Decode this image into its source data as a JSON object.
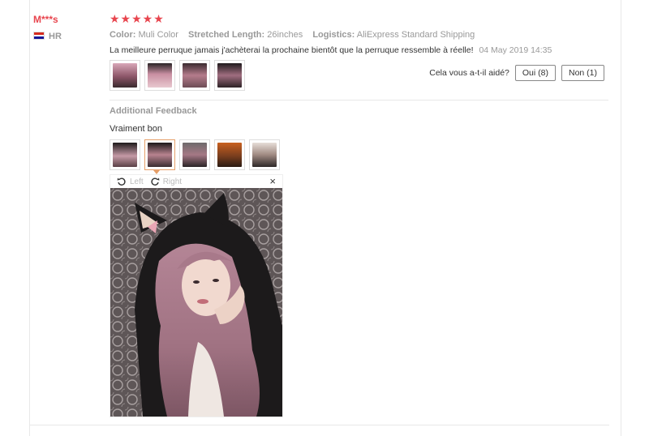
{
  "reviewer": {
    "name": "M***s",
    "country": "HR"
  },
  "rating": {
    "stars": "★★★★★"
  },
  "meta": {
    "color_label": "Color:",
    "color_value": "Muli Color",
    "length_label": "Stretched Length:",
    "length_value": "26inches",
    "logistics_label": "Logistics:",
    "logistics_value": "AliExpress Standard Shipping"
  },
  "review": {
    "text": "La meilleure perruque jamais j'achèterai la prochaine bientôt que la perruque ressemble à réelle!",
    "date": "04 May 2019 14:35"
  },
  "helpful": {
    "question": "Cela vous a-t-il aidé?",
    "yes_label": "Oui (8)",
    "no_label": "Non (1)"
  },
  "additional": {
    "title": "Additional Feedback",
    "text": "Vraiment bon"
  },
  "viewer": {
    "left_label": "Left",
    "right_label": "Right",
    "close_label": "×"
  },
  "colors": {
    "accent": "#e8454e",
    "muted": "#999999",
    "active_border": "#e6a06a"
  }
}
